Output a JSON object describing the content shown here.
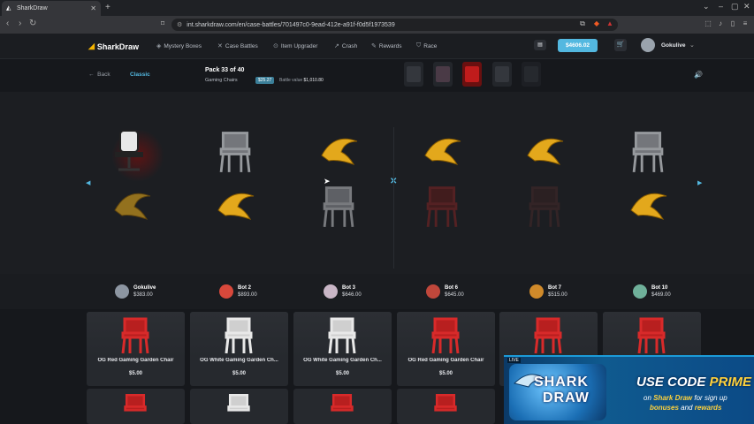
{
  "browser": {
    "tab_title": "SharkDraw",
    "url": "int.sharkdraw.com/en/case-battles/701497c0-9ead-412e-a91f-f0d5f1973539"
  },
  "site": {
    "logo": "SharkDraw",
    "nav": [
      "Mystery Boxes",
      "Case Battles",
      "Item Upgrader",
      "Crash",
      "Rewards",
      "Race"
    ],
    "balance": "$4606.02",
    "username": "Gokulive"
  },
  "battle": {
    "back_label": "Back",
    "mode": "Classic",
    "pack_title": "Pack 33 of 40",
    "case_name": "Gaming Chairs",
    "case_price": "$25.27",
    "battle_value_label": "Battle value",
    "battle_value": "$1,010.80"
  },
  "players": [
    {
      "name": "Gokulive",
      "value": "$383.00",
      "color": "#8d96a2"
    },
    {
      "name": "Bot 2",
      "value": "$893.00",
      "color": "#d8483b"
    },
    {
      "name": "Bot 3",
      "value": "$646.00",
      "color": "#c9b6c6"
    },
    {
      "name": "Bot 6",
      "value": "$645.00",
      "color": "#c0473b"
    },
    {
      "name": "Bot 7",
      "value": "$515.00",
      "color": "#d08a2a"
    },
    {
      "name": "Bot 10",
      "value": "$469.00",
      "color": "#6fb09a"
    }
  ],
  "won_items": [
    {
      "name": "OG Red Gaming Garden Chair",
      "price": "$5.00",
      "color": "#d82a2a"
    },
    {
      "name": "OG White Gaming Garden Ch...",
      "price": "$5.00",
      "color": "#e8e8e8"
    },
    {
      "name": "OG White Gaming Garden Ch...",
      "price": "$5.00",
      "color": "#e8e8e8"
    },
    {
      "name": "OG Red Gaming Garden Chair",
      "price": "$5.00",
      "color": "#d82a2a"
    },
    {
      "name": "",
      "price": "",
      "color": "#d82a2a"
    },
    {
      "name": "",
      "price": "",
      "color": "#d82a2a"
    }
  ],
  "promo": {
    "live": "LIVE",
    "logo_line1": "SHARK",
    "logo_line2": "DRAW",
    "line1_a": "USE CODE ",
    "line1_b": "PRIME",
    "line2_a": "on ",
    "line2_b": "Shark Draw",
    "line2_c": " for sign up",
    "line3_a": "bonuses",
    "line3_b": " and ",
    "line3_c": "rewards"
  },
  "colors": {
    "accent": "#53b8e0",
    "gold": "#f5b400",
    "red_chair": "#d82a2a"
  }
}
